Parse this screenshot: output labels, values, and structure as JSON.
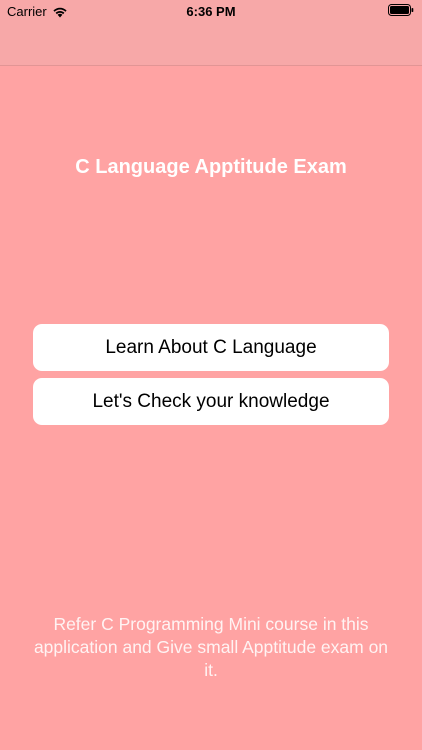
{
  "status_bar": {
    "carrier": "Carrier",
    "time": "6:36 PM",
    "wifi_icon": "wifi-icon",
    "battery_icon": "battery-icon"
  },
  "colors": {
    "background": "#ffa3a3",
    "nav_bar": "#f7a8a8",
    "button_bg": "#ffffff",
    "title_text": "#ffffff"
  },
  "main": {
    "title": "C Language Apptitude Exam",
    "buttons": [
      {
        "label": "Learn About C Language"
      },
      {
        "label": "Let's Check your knowledge"
      }
    ],
    "footer": "Refer C Programming Mini course in this application and Give small Apptitude exam on it."
  }
}
